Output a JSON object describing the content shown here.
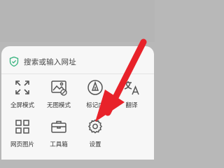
{
  "search": {
    "placeholder": "搜索或输入网址",
    "icon": "shield-check-icon"
  },
  "menu": {
    "items": [
      {
        "label": "全屏模式",
        "icon": "fullscreen-arrows-icon"
      },
      {
        "label": "无图模式",
        "icon": "no-image-icon"
      },
      {
        "label": "标记广",
        "icon": "pen-circle-icon"
      },
      {
        "label": "翻译",
        "icon": "translate-icon"
      },
      {
        "label": "网页图片",
        "icon": "grid-icon"
      },
      {
        "label": "工具箱",
        "icon": "toolbox-icon"
      },
      {
        "label": "设置",
        "icon": "gear-icon"
      }
    ]
  },
  "annotation": {
    "arrow_color": "#e8222a"
  },
  "colors": {
    "shield_green": "#36b37e",
    "icon_gray": "#555555"
  }
}
